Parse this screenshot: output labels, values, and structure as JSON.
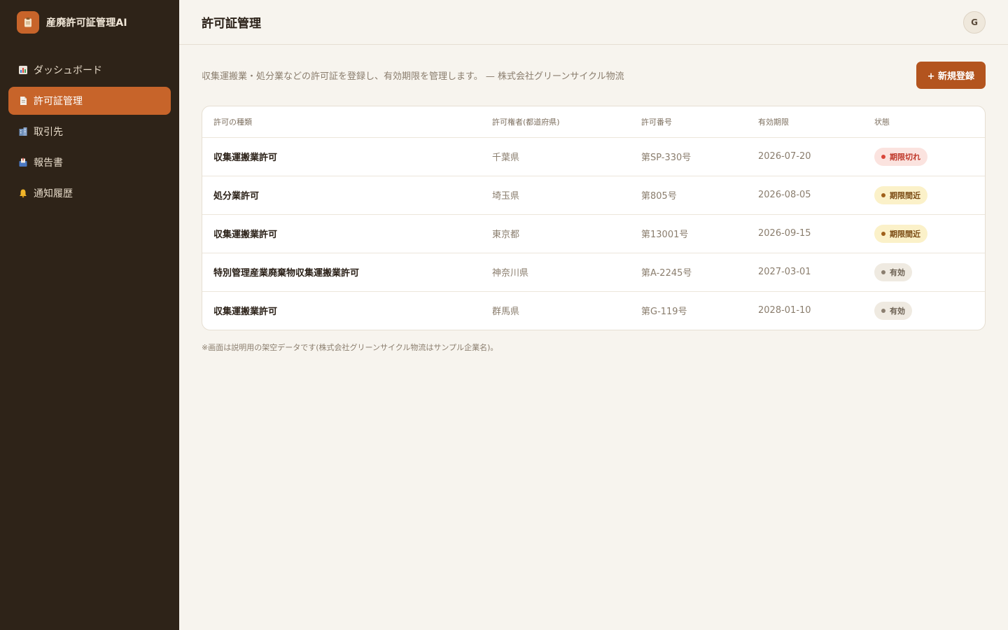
{
  "app": {
    "title": "産廃許可証管理AI"
  },
  "sidebar": {
    "items": [
      {
        "label": "ダッシュボード",
        "icon": "bar-chart-icon",
        "active": false
      },
      {
        "label": "許可証管理",
        "icon": "document-icon",
        "active": true
      },
      {
        "label": "取引先",
        "icon": "building-icon",
        "active": false
      },
      {
        "label": "報告書",
        "icon": "inbox-icon",
        "active": false
      },
      {
        "label": "通知履歴",
        "icon": "bell-icon",
        "active": false
      }
    ]
  },
  "header": {
    "title": "許可証管理",
    "avatar_initial": "G"
  },
  "main": {
    "intro": "収集運搬業・処分業などの許可証を登録し、有効期限を管理します。 — 株式会社グリーンサイクル物流",
    "new_button_label": "+ 新規登録",
    "table": {
      "columns": [
        "許可の種類",
        "許可権者(都道府県)",
        "許可番号",
        "有効期限",
        "状態"
      ],
      "rows": [
        {
          "type": "収集運搬業許可",
          "authority": "千葉県",
          "number": "第SP-330号",
          "expiry": "2026-07-20",
          "status": "期限切れ",
          "status_kind": "expired"
        },
        {
          "type": "処分業許可",
          "authority": "埼玉県",
          "number": "第805号",
          "expiry": "2026-08-05",
          "status": "期限間近",
          "status_kind": "soon"
        },
        {
          "type": "収集運搬業許可",
          "authority": "東京都",
          "number": "第13001号",
          "expiry": "2026-09-15",
          "status": "期限間近",
          "status_kind": "soon"
        },
        {
          "type": "特別管理産業廃棄物収集運搬業許可",
          "authority": "神奈川県",
          "number": "第A-2245号",
          "expiry": "2027-03-01",
          "status": "有効",
          "status_kind": "valid"
        },
        {
          "type": "収集運搬業許可",
          "authority": "群馬県",
          "number": "第G-119号",
          "expiry": "2028-01-10",
          "status": "有効",
          "status_kind": "valid"
        }
      ]
    },
    "footnote": "※画面は説明用の架空データです(株式会社グリーンサイクル物流はサンプル企業名)。"
  },
  "colors": {
    "sidebar_bg": "#2e2318",
    "accent": "#c7642a",
    "primary_button": "#b3541e",
    "expired": "#d9463a",
    "soon": "#a0611b",
    "valid": "#8b7f70"
  }
}
